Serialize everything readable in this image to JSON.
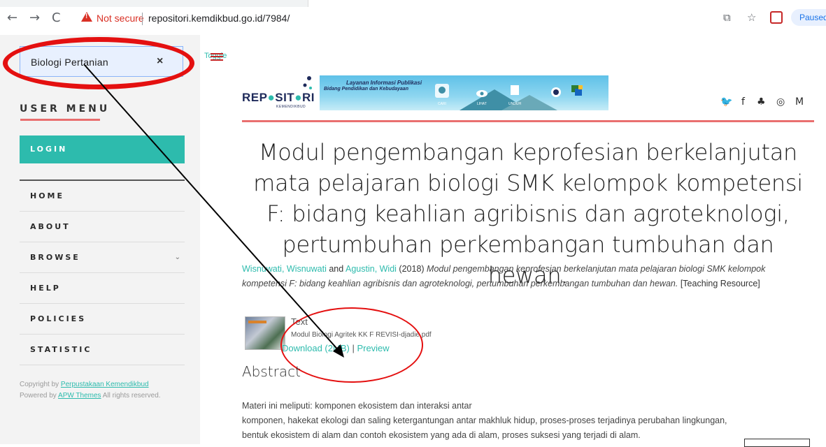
{
  "browser": {
    "not_secure": "Not secure",
    "url": "repositori.kemdikbud.go.id/7984/",
    "paused": "Paused"
  },
  "search": {
    "value": "Biologi Pertanian",
    "clear": "×"
  },
  "toggle": "Toggle",
  "sidebar": {
    "user_menu_title": "USER MENU",
    "login": "LOGIN",
    "items": [
      {
        "label": "HOME"
      },
      {
        "label": "ABOUT"
      },
      {
        "label": "BROWSE",
        "chevron": "⌄"
      },
      {
        "label": "HELP"
      },
      {
        "label": "POLICIES"
      },
      {
        "label": "STATISTIC"
      }
    ],
    "copyright": {
      "prefix": "Copyright by ",
      "org": "Perpustakaan Kemendikbud",
      "powered_prefix": "Powered by ",
      "theme": "APW Themes",
      "suffix": " All rights reserved."
    }
  },
  "header": {
    "logo_main_a": "REP",
    "logo_main_o": "●",
    "logo_main_b": "SIT",
    "logo_main_c": "RI",
    "logo_sub": "KEMENDIKBUD",
    "banner_line1": "Layanan Informasi Publikasi",
    "banner_line2": "Bidang Pendidikan dan Kebudayaan",
    "banner_labels": [
      "CARI",
      "LIHAT",
      "UNDUH"
    ]
  },
  "main": {
    "title": "Modul pengembangan keprofesian berkelanjutan mata pelajaran biologi SMK kelompok kompetensi F: bidang keahlian agribisnis dan agroteknologi, pertumbuhan perkembangan tumbuhan dan hewan.",
    "citation": {
      "author1": "Wisnuwati, Wisnuwati",
      "and": " and ",
      "author2": "Agustin, Widi",
      "year": " (2018) ",
      "title_italic": "Modul pengembangan keprofesian berkelanjutan mata pelajaran biologi SMK kelompok kompetensi F: bidang keahlian agribisnis dan agroteknologi, pertumbuhan perkembangan tumbuhan dan hewan.",
      "type": " [Teaching Resource]"
    },
    "file": {
      "type": "Text",
      "name": "Modul Biologi Agritek KK F REVISI-djadie.pdf",
      "download": "Download (2MB)",
      "pipe": " | ",
      "preview": "Preview"
    },
    "abstract_heading": "Abstract",
    "abstract_lines": [
      "Materi ini meliputi: komponen ekosistem dan interaksi antar",
      "komponen, hakekat ekologi dan saling ketergantungan antar makhluk hidup, proses-proses terjadinya perubahan lingkungan,",
      "bentuk ekosistem di alam dan contoh ekosistem yang ada di alam, proses suksesi yang terjadi di alam."
    ]
  }
}
